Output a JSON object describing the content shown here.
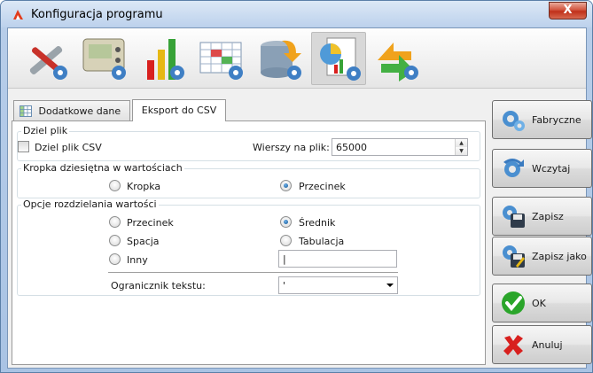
{
  "window": {
    "title": "Konfiguracja programu",
    "close_glyph": "X"
  },
  "toolbar": {
    "icons": [
      "tools-icon",
      "device-settings-icon",
      "charts-settings-icon",
      "table-settings-icon",
      "database-icon",
      "report-settings-icon",
      "export-icon"
    ],
    "active_index": 5
  },
  "tabs": [
    {
      "label": "Dodatkowe dane",
      "icon": "grid-icon",
      "active": false
    },
    {
      "label": "Eksport do CSV",
      "active": true
    }
  ],
  "split": {
    "legend": "Dziel plik",
    "checkbox_label": "Dziel plik CSV",
    "checkbox_checked": false,
    "rows_label": "Wierszy na plik:",
    "rows_value": "65000"
  },
  "decimal": {
    "legend": "Kropka dziesiętna w wartościach",
    "options": [
      {
        "label": "Kropka",
        "selected": false
      },
      {
        "label": "Przecinek",
        "selected": true
      }
    ]
  },
  "separator": {
    "legend": "Opcje rozdzielania wartości",
    "options": [
      {
        "label": "Przecinek",
        "selected": false
      },
      {
        "label": "Średnik",
        "selected": true
      },
      {
        "label": "Spacja",
        "selected": false
      },
      {
        "label": "Tabulacja",
        "selected": false
      },
      {
        "label": "Inny",
        "selected": false
      }
    ],
    "other_value": "|",
    "quote_label": "Ogranicznik tekstu:",
    "quote_value": "'"
  },
  "buttons": {
    "factory": "Fabryczne",
    "load": "Wczytaj",
    "save": "Zapisz",
    "save_as": "Zapisz jako",
    "ok": "OK",
    "cancel": "Anuluj"
  },
  "colors": {
    "title_bar": "#bcd1ec",
    "close_button": "#c0301a",
    "radio_selected": "#0e4f8a",
    "ok_green": "#2aa52a",
    "cancel_red": "#d8201e"
  }
}
